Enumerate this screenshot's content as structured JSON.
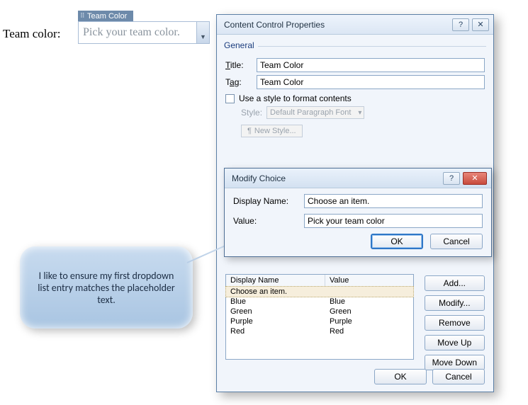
{
  "doc": {
    "label": "Team color:",
    "cc_title_tab": "Team Color",
    "placeholder": "Pick your team color."
  },
  "dialog": {
    "title": "Content Control Properties",
    "help_glyph": "?",
    "close_glyph": "✕",
    "section_general": "General",
    "title_label_pre": "T",
    "title_label": "itle:",
    "title_value": "Team Color",
    "tag_label_pre": "T",
    "tag_label_u": "a",
    "tag_label_post": "g:",
    "tag_value": "Team Color",
    "use_style_u": "U",
    "use_style_post": "se a style to format contents",
    "style_label_u": "S",
    "style_label_post": "tyle:",
    "style_value": "Default Paragraph Font",
    "new_style": "New Style...",
    "list_hdr_name": "Display Name",
    "list_hdr_value": "Value",
    "list": [
      {
        "name": "Choose an item.",
        "value": "",
        "selected": true
      },
      {
        "name": "Blue",
        "value": "Blue"
      },
      {
        "name": "Green",
        "value": "Green"
      },
      {
        "name": "Purple",
        "value": "Purple"
      },
      {
        "name": "Red",
        "value": "Red"
      }
    ],
    "btn_add": "Add...",
    "btn_modify": "Modify...",
    "btn_remove": "Remove",
    "btn_moveup": "Move Up",
    "btn_movedown": "Move Down",
    "btn_ok": "OK",
    "btn_cancel": "Cancel"
  },
  "modify": {
    "title": "Modify Choice",
    "help_glyph": "?",
    "close_glyph": "✕",
    "display_label_pre": "Display ",
    "display_label_u": "N",
    "display_label_post": "ame:",
    "display_value": "Choose an item.",
    "value_label_u": "V",
    "value_label_post": "alue:",
    "value_value": "Pick your team color",
    "btn_ok": "OK",
    "btn_cancel": "Cancel"
  },
  "callout": {
    "text": "I like to ensure my first dropdown list entry matches the placeholder text."
  }
}
